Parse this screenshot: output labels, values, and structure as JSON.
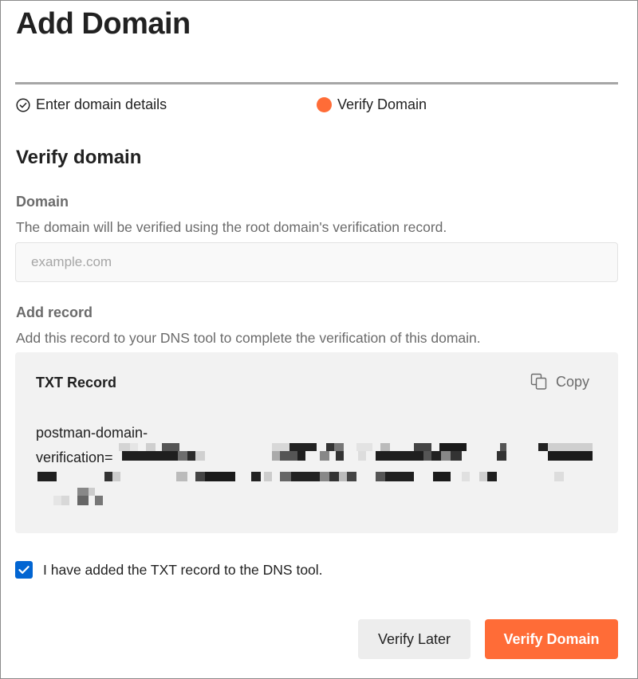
{
  "dialog": {
    "title": "Add Domain"
  },
  "stepper": {
    "steps": [
      {
        "label": "Enter domain details",
        "state": "completed"
      },
      {
        "label": "Verify Domain",
        "state": "active"
      }
    ],
    "active_color": "#ff6c37"
  },
  "verify": {
    "heading": "Verify domain",
    "domain_label": "Domain",
    "domain_help": "The domain will be verified using the root domain's verification record.",
    "domain_value": "",
    "domain_placeholder": "example.com",
    "record_label": "Add record",
    "record_help": "Add this record to your DNS tool to complete the verification of this domain.",
    "record_box": {
      "title": "TXT Record",
      "copy_label": "Copy",
      "value_prefix_line1": "postman-domain-",
      "value_prefix_line2": "verification="
    },
    "confirm_checkbox": {
      "label": "I have added the TXT record to the DNS tool.",
      "checked": true
    }
  },
  "footer": {
    "secondary_label": "Verify Later",
    "primary_label": "Verify Domain"
  },
  "colors": {
    "accent": "#ff6c37",
    "checkbox": "#0265d2"
  }
}
